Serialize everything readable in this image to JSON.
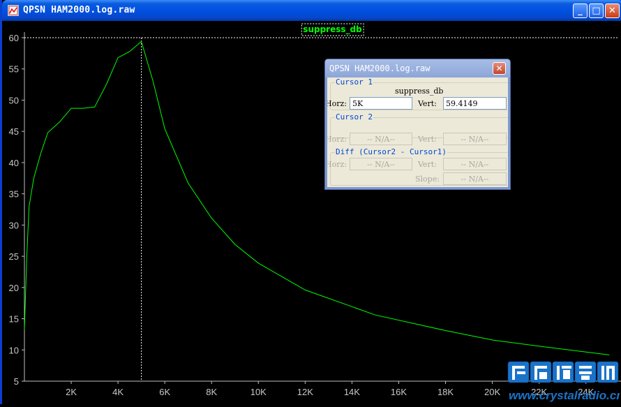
{
  "window": {
    "title": "QPSN HAM2000.log.raw"
  },
  "title_buttons": {
    "minimize": "_",
    "maximize": "□",
    "close": "✕"
  },
  "chart_data": {
    "type": "line",
    "series": [
      {
        "name": "suppress_db",
        "color": "#00ff00",
        "x": [
          0,
          100,
          200,
          400,
          700,
          1000,
          1500,
          2000,
          2500,
          3000,
          3500,
          4000,
          4500,
          5000,
          5500,
          6000,
          7000,
          8000,
          9000,
          10000,
          12000,
          15000,
          18000,
          20000,
          22000,
          25000
        ],
        "y": [
          13.3,
          25,
          33,
          37.5,
          41.5,
          44.8,
          46.5,
          48.7,
          48.7,
          48.9,
          52.5,
          56.8,
          57.8,
          59.4,
          53,
          45.4,
          36.7,
          31.1,
          26.9,
          23.9,
          19.6,
          15.6,
          13.1,
          11.6,
          10.6,
          9.2
        ]
      }
    ],
    "x_ticks": [
      "2K",
      "4K",
      "6K",
      "8K",
      "10K",
      "12K",
      "14K",
      "16K",
      "18K",
      "20K",
      "22K",
      "24K"
    ],
    "x_tick_values": [
      2000,
      4000,
      6000,
      8000,
      10000,
      12000,
      14000,
      16000,
      18000,
      20000,
      22000,
      24000
    ],
    "y_ticks": [
      5,
      10,
      15,
      20,
      25,
      30,
      35,
      40,
      45,
      50,
      55,
      60
    ],
    "xlim": [
      0,
      25500
    ],
    "ylim": [
      5,
      60
    ],
    "cursor_x": 5000,
    "background": "#000000",
    "axis_color": "#c0c0c0"
  },
  "cursor_dialog": {
    "title": "QPSN HAM2000.log.raw",
    "close": "✕",
    "cursor1": {
      "label": "Cursor 1",
      "trace": "suppress_db",
      "horz_label": "Horz:",
      "horz_value": "5K",
      "vert_label": "Vert:",
      "vert_value": "59.4149"
    },
    "cursor2": {
      "label": "Cursor 2",
      "horz_label": "Horz:",
      "horz_value": "-- N/A--",
      "vert_label": "Vert:",
      "vert_value": "-- N/A--"
    },
    "diff": {
      "label": "Diff (Cursor2 - Cursor1)",
      "horz_label": "Horz:",
      "horz_value": "-- N/A--",
      "vert_label": "Vert:",
      "vert_value": "-- N/A--",
      "slope_label": "Slope:",
      "slope_value": "-- N/A--"
    }
  },
  "watermark": {
    "cn_text": "矿石收音机",
    "url": "www.crystalradio.cn"
  }
}
